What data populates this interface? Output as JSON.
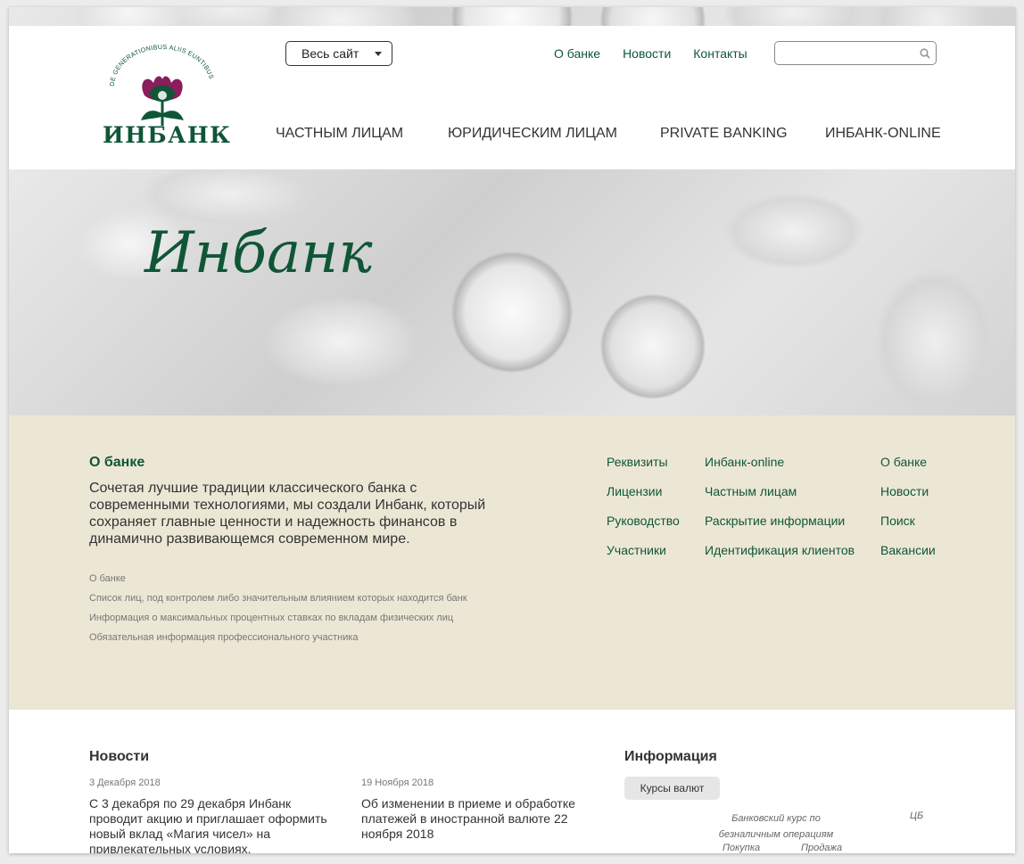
{
  "header": {
    "logo_motto": "DE GENERATIONIBUS ALIIS EUNTIBUS",
    "logo_name": "ИНБАНК",
    "site_select": "Весь сайт",
    "top_links": [
      "О банке",
      "Новости",
      "Контакты"
    ],
    "search_placeholder": "",
    "main_nav": [
      "ЧАСТНЫМ ЛИЦАМ",
      "ЮРИДИЧЕСКИМ ЛИЦАМ",
      "PRIVATE BANKING",
      "ИНБАНК-ONLINE"
    ]
  },
  "hero": {
    "title": "Инбанк"
  },
  "about": {
    "title": "О банке",
    "text": "Сочетая лучшие традиции классического банка с современными технологиями, мы создали Инбанк, который сохраняет главные ценности и надежность финансов в динамично развивающемся современном мире.",
    "docs": [
      "О банке",
      "Список лиц, под контролем либо значительным влиянием которых находится банк",
      "Информация о максимальных процентных ставках по вкладам физических лиц",
      "Обязательная информация профессионального участника"
    ],
    "link_col1": [
      "Реквизиты",
      "Лицензии",
      "Руководство",
      "Участники"
    ],
    "link_col2": [
      "Инбанк-online",
      "Частным лицам",
      "Раскрытие информации",
      "Идентификация клиентов"
    ],
    "link_col3": [
      "О банке",
      "Новости",
      "Поиск",
      "Вакансии"
    ]
  },
  "news": {
    "title": "Новости",
    "items": [
      {
        "date": "3 Декабря 2018",
        "text": "С 3 декабря по 29 декабря Инбанк проводит акцию и приглашает оформить новый вклад «Магия чисел» на привлекательных условиях."
      },
      {
        "date": "19 Ноября 2018",
        "text": "Об изменении в приеме и обработке платежей в иностранной валюте 22 ноября 2018"
      }
    ]
  },
  "info": {
    "title": "Информация",
    "tab": "Курсы валют",
    "bank_rate_header": "Банковский курс по безналичным операциям",
    "cb_header": "ЦБ",
    "buy_header": "Покупка",
    "sell_header": "Продажа"
  },
  "colors": {
    "brand_green": "#0f5637",
    "brand_purple": "#8a1d5c",
    "beige": "#ece7d5"
  }
}
